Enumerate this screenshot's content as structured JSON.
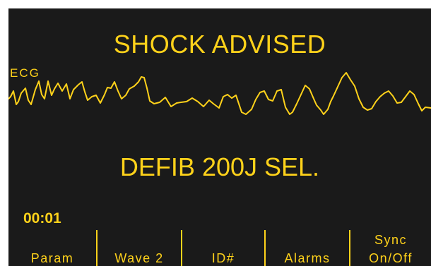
{
  "colors": {
    "screen_bg": "#1a1a1a",
    "text": "#ffd21a",
    "trace": "#ffd21a"
  },
  "alert": {
    "title": "SHOCK ADVISED"
  },
  "waveform": {
    "label": "ECG"
  },
  "energy": {
    "message": "DEFIB 200J SEL."
  },
  "timer": {
    "value": "00:01"
  },
  "softkeys": [
    {
      "label": "Param"
    },
    {
      "label": "Wave 2"
    },
    {
      "label": "ID#"
    },
    {
      "label": "Alarms"
    },
    {
      "label_line1": "Sync",
      "label_line2": "On/Off"
    }
  ]
}
